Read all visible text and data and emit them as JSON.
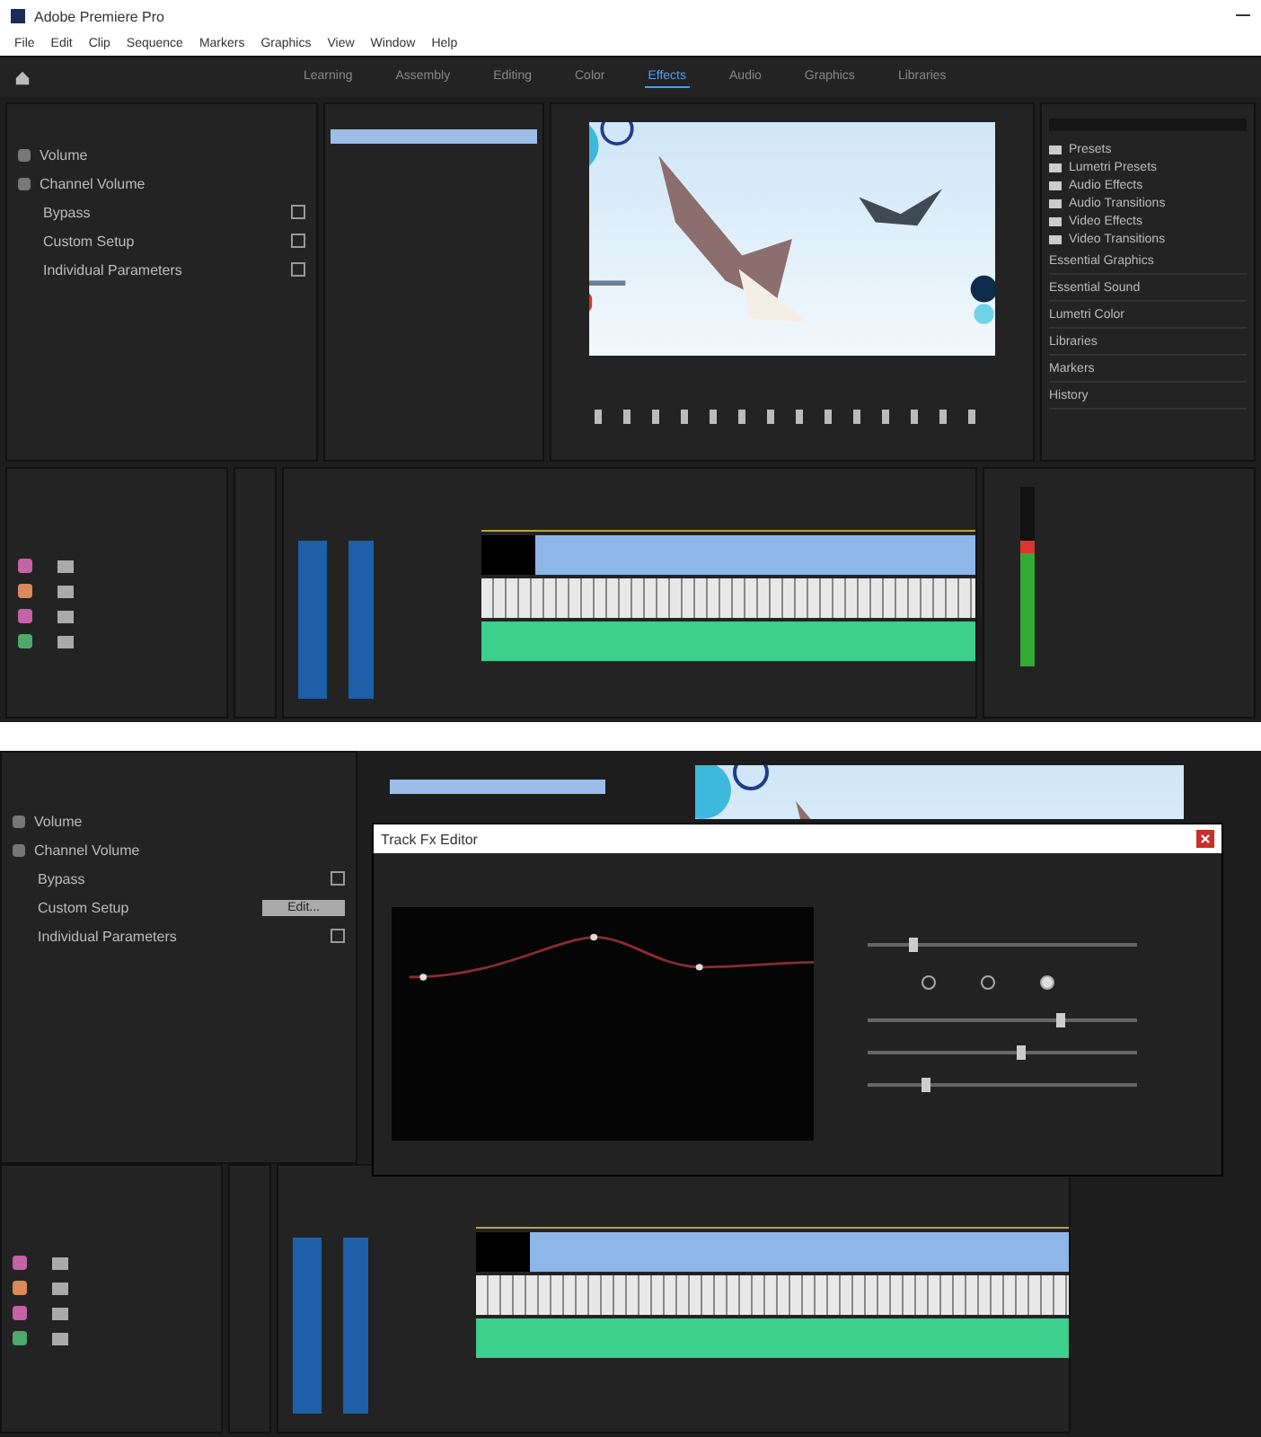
{
  "top": {
    "window": {
      "title": "Adobe Premiere Pro"
    },
    "menu": [
      "File",
      "Edit",
      "Clip",
      "Sequence",
      "Markers",
      "Graphics",
      "View",
      "Window",
      "Help"
    ],
    "workspaces": [
      {
        "label": "Learning",
        "selected": false
      },
      {
        "label": "Assembly",
        "selected": false
      },
      {
        "label": "Editing",
        "selected": false
      },
      {
        "label": "Color",
        "selected": false
      },
      {
        "label": "Effects",
        "selected": true
      },
      {
        "label": "Audio",
        "selected": false
      },
      {
        "label": "Graphics",
        "selected": false
      },
      {
        "label": "Libraries",
        "selected": false
      }
    ],
    "effect_controls": [
      {
        "kind": "effect",
        "label": "Volume"
      },
      {
        "kind": "effect",
        "label": "Channel Volume"
      },
      {
        "kind": "param",
        "label": "Bypass",
        "checked": false
      },
      {
        "kind": "param",
        "label": "Custom Setup",
        "checked": false
      },
      {
        "kind": "param",
        "label": "Individual Parameters",
        "checked": false
      }
    ],
    "effects": [
      "Presets",
      "Lumetri Presets",
      "Audio Effects",
      "Audio Transitions",
      "Video Effects",
      "Video Transitions"
    ],
    "panels": [
      "Essential Graphics",
      "Essential Sound",
      "Lumetri Color",
      "Libraries",
      "Markers",
      "History"
    ],
    "project_items": [
      {
        "color": "#c463a8"
      },
      {
        "color": "#d9895a"
      },
      {
        "color": "#c463a8"
      },
      {
        "color": "#4fa86b"
      }
    ],
    "meter": {
      "level": 0.7
    }
  },
  "bottom": {
    "effect_controls": [
      {
        "kind": "effect",
        "label": "Volume"
      },
      {
        "kind": "effect",
        "label": "Channel Volume"
      },
      {
        "kind": "param",
        "label": "Bypass",
        "checked": false
      },
      {
        "kind": "button",
        "label": "Custom Setup",
        "button": "Edit..."
      },
      {
        "kind": "param",
        "label": "Individual Parameters",
        "checked": false
      }
    ],
    "dialog": {
      "title": "Track Fx Editor",
      "sliders": [
        {
          "level": 0.15
        },
        {
          "level": 0.7
        },
        {
          "level": 0.55
        },
        {
          "level": 0.2
        }
      ],
      "radios": [
        {
          "selected": false
        },
        {
          "selected": false
        },
        {
          "selected": true
        }
      ]
    },
    "project_items": [
      {
        "color": "#c463a8"
      },
      {
        "color": "#d9895a"
      },
      {
        "color": "#c463a8"
      },
      {
        "color": "#4fa86b"
      }
    ]
  }
}
